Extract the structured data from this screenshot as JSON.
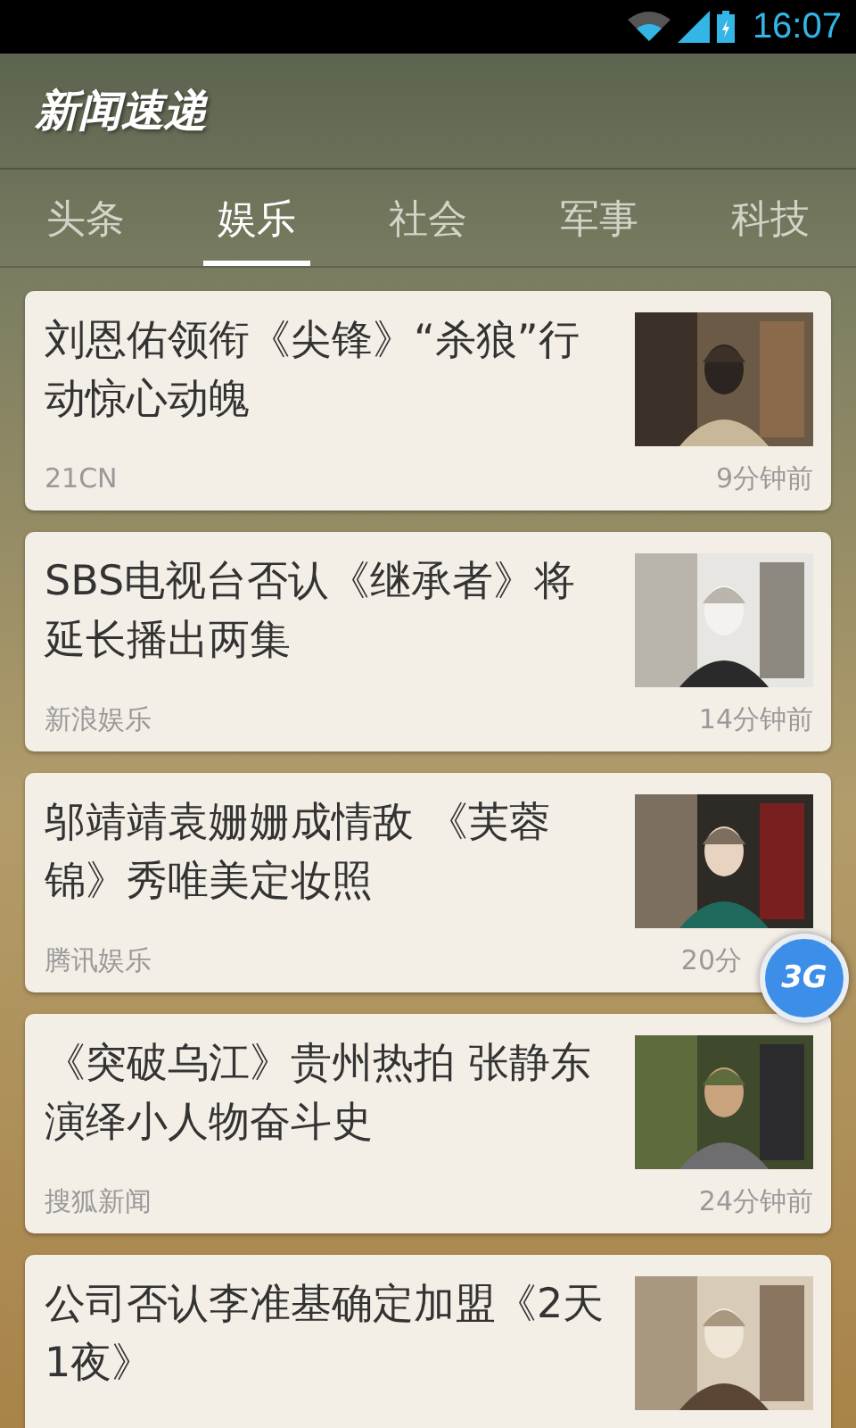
{
  "status_bar": {
    "time": "16:07"
  },
  "app_bar": {
    "title": "新闻速递"
  },
  "tabs": [
    {
      "label": "头条",
      "selected": false
    },
    {
      "label": "娱乐",
      "selected": true
    },
    {
      "label": "社会",
      "selected": false
    },
    {
      "label": "军事",
      "selected": false
    },
    {
      "label": "科技",
      "selected": false
    }
  ],
  "articles": [
    {
      "title": "刘恩佑领衔《尖锋》“杀狼”行动惊心动魄",
      "source": "21CN",
      "time": "9分钟前"
    },
    {
      "title": "SBS电视台否认《继承者》将延长播出两集",
      "source": "新浪娱乐",
      "time": "14分钟前"
    },
    {
      "title": "邬靖靖袁姗姗成情敌 《芙蓉锦》秀唯美定妆照",
      "source": "腾讯娱乐",
      "time": "20分",
      "floating_button": {
        "label": "3G"
      }
    },
    {
      "title": "《突破乌江》贵州热拍 张静东演绎小人物奋斗史",
      "source": "搜狐新闻",
      "time": "24分钟前"
    },
    {
      "title": "公司否认李准基确定加盟《2天1夜》"
    }
  ]
}
